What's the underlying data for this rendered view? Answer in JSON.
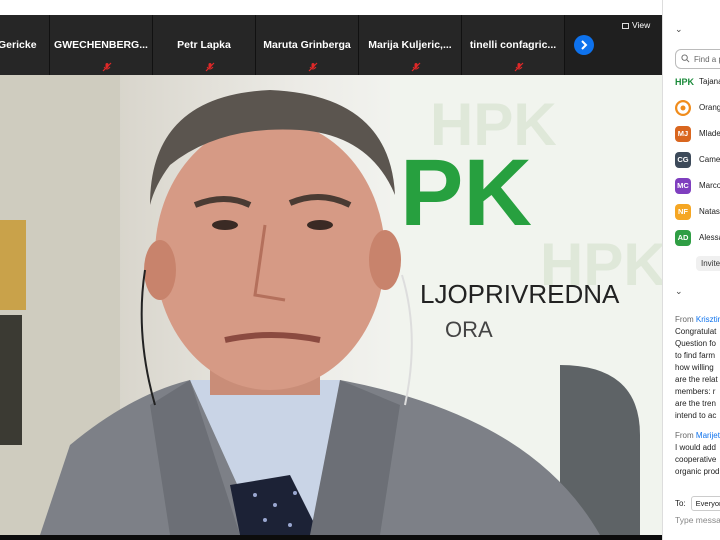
{
  "thumbnails": [
    {
      "name": "Gericke"
    },
    {
      "name": "GWECHENBERG..."
    },
    {
      "name": "Petr Lapka"
    },
    {
      "name": "Maruta Grinberga"
    },
    {
      "name": "Marija  Kuljeric,..."
    },
    {
      "name": "tinelli  confagric..."
    }
  ],
  "view_label": "View",
  "speaker_background_text": {
    "logo": "PK",
    "org_line1": "LJOPRIVREDNA",
    "org_line2": "ORA"
  },
  "search": {
    "placeholder": "Find a p"
  },
  "participants": [
    {
      "initials": "HPK",
      "name": "Tajana",
      "color": "#1a8a3a"
    },
    {
      "initials": "",
      "name": "Orang",
      "color": "#f08c1c"
    },
    {
      "initials": "MJ",
      "name": "Mlade",
      "color": "#d9661f"
    },
    {
      "initials": "CG",
      "name": "Came",
      "color": "#3d4a5a"
    },
    {
      "initials": "MC",
      "name": "Marco",
      "color": "#7f3fbf"
    },
    {
      "initials": "NF",
      "name": "Natas",
      "color": "#f5a623"
    },
    {
      "initials": "AD",
      "name": "Alessa",
      "color": "#2f9e44"
    }
  ],
  "invite_label": "Invite",
  "chat": {
    "msg1": {
      "from_prefix": "From",
      "sender": "Krisztin",
      "lines": [
        "Congratulat",
        "Question fo",
        "to find farm",
        "how willing",
        "are the relat",
        "members: r",
        "are the tren",
        "intend to ac"
      ]
    },
    "msg2": {
      "from_prefix": "From",
      "sender": "Marijeta",
      "lines": [
        "I would add",
        "cooperative",
        "organic prod"
      ]
    },
    "to_label": "To:",
    "to_value": "Everyone",
    "input_placeholder": "Type message"
  },
  "colors": {
    "accent": "#0e72ed",
    "panel_bg": "#ffffff",
    "video_bg": "#1a1a1a",
    "muted_mic": "#e02828"
  }
}
